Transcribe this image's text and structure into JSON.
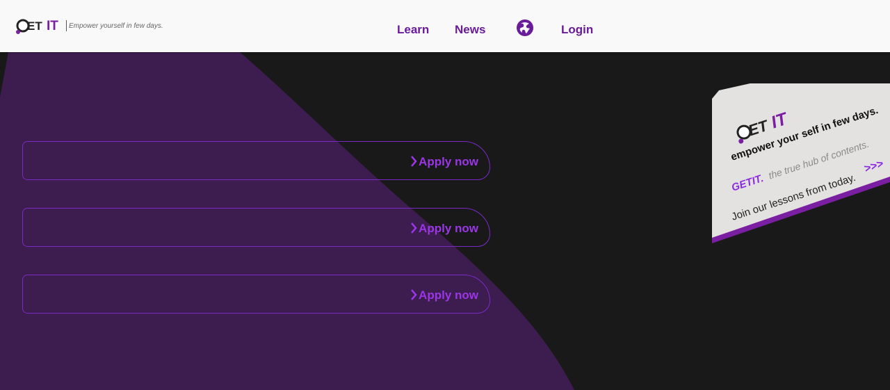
{
  "header": {
    "logo_text": "GET IT",
    "tagline": "Empower yourself in few days.",
    "nav": {
      "learn": "Learn",
      "news": "News",
      "login": "Login"
    }
  },
  "hero": {
    "apply_cards": [
      {
        "label": "Apply now"
      },
      {
        "label": "Apply now"
      },
      {
        "label": "Apply now"
      }
    ]
  },
  "promo": {
    "logo_text": "GET IT",
    "headline": "empower your self in few days.",
    "brand": "GETIT.",
    "sub": "the true hub of contents.",
    "cta": "Join our lessons from today.",
    "arrows": ">>>"
  },
  "colors": {
    "accent": "#7b1fa2",
    "nav_text": "#6a1b9a",
    "apply_text": "#9a36e6",
    "hero_purple": "#3d1c4f",
    "background": "#191919",
    "card_bg": "#e4e1e1"
  }
}
